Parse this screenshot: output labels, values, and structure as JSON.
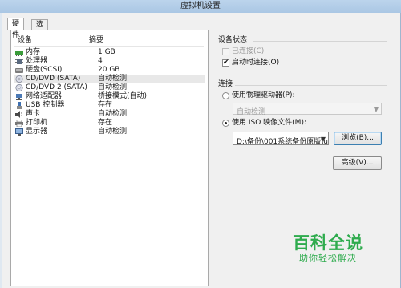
{
  "window": {
    "title": "虚拟机设置"
  },
  "tabs": [
    {
      "label": "硬件",
      "active": true
    },
    {
      "label": "选项",
      "active": false
    }
  ],
  "device_list": {
    "headers": {
      "device": "设备",
      "summary": "摘要"
    },
    "rows": [
      {
        "name": "内存",
        "summary": "1 GB",
        "icon": "memory-icon"
      },
      {
        "name": "处理器",
        "summary": "4",
        "icon": "processor-icon"
      },
      {
        "name": "硬盘(SCSI)",
        "summary": "20 GB",
        "icon": "hard-disk-icon"
      },
      {
        "name": "CD/DVD (SATA)",
        "summary": "自动检测",
        "icon": "cd-dvd-icon",
        "selected": true
      },
      {
        "name": "CD/DVD 2 (SATA)",
        "summary": "自动检测",
        "icon": "cd-dvd-icon"
      },
      {
        "name": "网络适配器",
        "summary": "桥接模式(自动)",
        "icon": "network-adapter-icon"
      },
      {
        "name": "USB 控制器",
        "summary": "存在",
        "icon": "usb-icon"
      },
      {
        "name": "声卡",
        "summary": "自动检测",
        "icon": "sound-card-icon"
      },
      {
        "name": "打印机",
        "summary": "存在",
        "icon": "printer-icon"
      },
      {
        "name": "显示器",
        "summary": "自动检测",
        "icon": "display-icon"
      }
    ]
  },
  "device_status": {
    "title": "设备状态",
    "connected_label": "已连接(C)",
    "connected_checked": false,
    "connect_at_power_on_label": "启动时连接(O)",
    "connect_at_power_on_checked": true
  },
  "connection": {
    "title": "连接",
    "physical_drive_label": "使用物理驱动器(P):",
    "physical_drive_value": "自动检测",
    "iso_label": "使用 ISO 映像文件(M):",
    "iso_path": "D:\\备份\\001系统备份原版\\u",
    "browse_label": "浏览(B)...",
    "selected": "iso"
  },
  "advanced_label": "高级(V)...",
  "watermark": {
    "title": "百科全说",
    "subtitle": "助你轻松解决"
  },
  "colors": {
    "watermark": "#2eab4d",
    "titlebar": "#aac7e4"
  }
}
